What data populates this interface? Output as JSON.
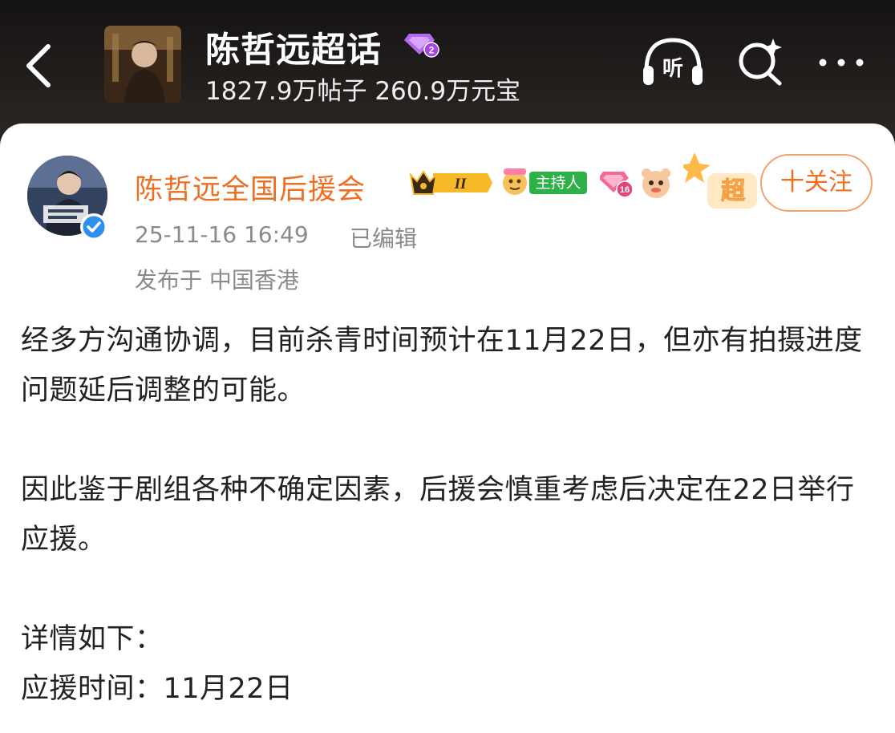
{
  "header": {
    "topic_title": "陈哲远超话",
    "topic_level": "2",
    "topic_stats": "1827.9万帖子 260.9万元宝",
    "listen_label": "听"
  },
  "post": {
    "author_name": "陈哲远全国后援会",
    "crown_level": "II",
    "host_badge": "主持人",
    "user_level": "16",
    "super_badge": "超",
    "follow_label": "十关注",
    "time": "25-11-16 16:49",
    "edited": "已编辑",
    "location": "发布于 中国香港",
    "paragraphs": [
      "经多方沟通协调，目前杀青时间预计在11月22日，但亦有拍摄进度问题延后调整的可能。",
      "因此鉴于剧组各种不确定因素，后援会慎重考虑后决定在22日举行应援。",
      "详情如下：",
      "应援时间：11月22日"
    ]
  },
  "colors": {
    "accent": "#ee6e22",
    "meta_text": "#8a8a8a",
    "host_green": "#2fb14a",
    "level_purple": "#a347e6",
    "verified_blue": "#2d8ff0"
  }
}
